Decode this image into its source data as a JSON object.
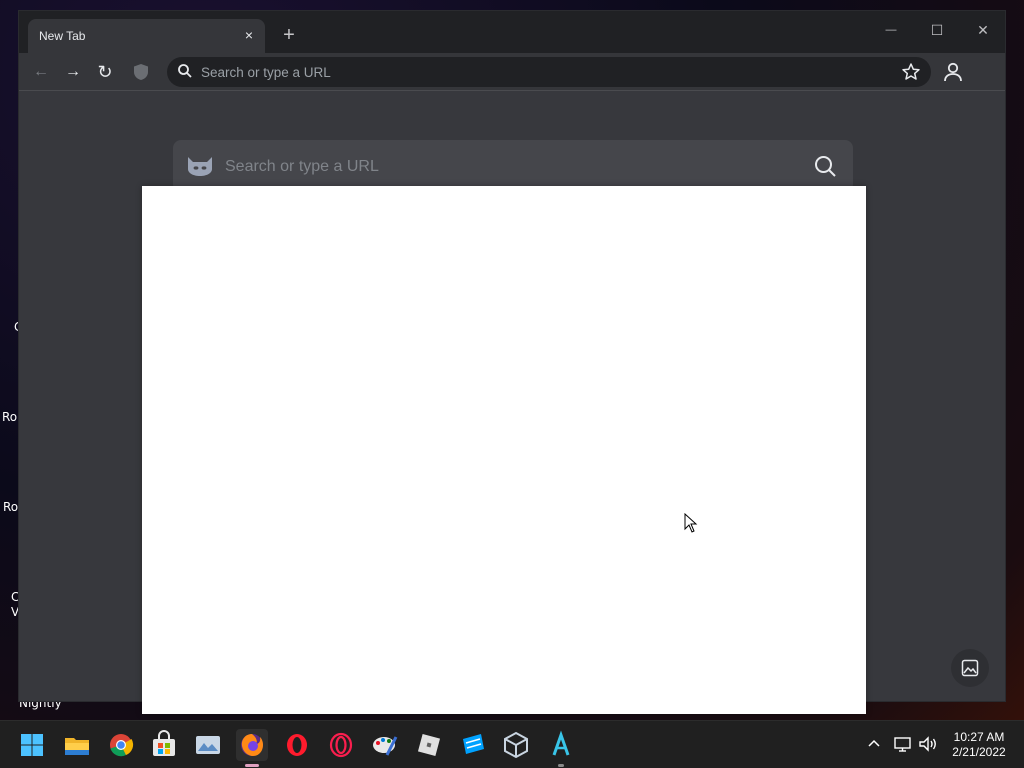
{
  "desktop": {
    "labels": [
      "C",
      "Rol",
      "Ro",
      "C",
      "V",
      "Nightly"
    ]
  },
  "browser": {
    "tab": {
      "title": "New Tab",
      "close_glyph": "×"
    },
    "new_tab_glyph": "+",
    "window_controls": {
      "minimize": "—",
      "maximize": "☐",
      "close": "✕"
    },
    "toolbar": {
      "back_glyph": "←",
      "forward_glyph": "→",
      "reload_glyph": "↻",
      "omnibox_placeholder": "Search or type a URL"
    },
    "ntp": {
      "search_placeholder": "Search or type a URL"
    }
  },
  "taskbar": {
    "apps": [
      "start",
      "file-explorer",
      "chrome",
      "microsoft-store",
      "photos",
      "firefox",
      "opera",
      "opera-gx",
      "paint",
      "roblox",
      "roblox-studio",
      "virtualbox",
      "arc"
    ],
    "active_app": "firefox",
    "clock": {
      "time": "10:27 AM",
      "date": "2/21/2022"
    }
  },
  "colors": {
    "window_bg": "#37383d",
    "titlebar": "#202124",
    "accent": "#e0a0c0"
  }
}
